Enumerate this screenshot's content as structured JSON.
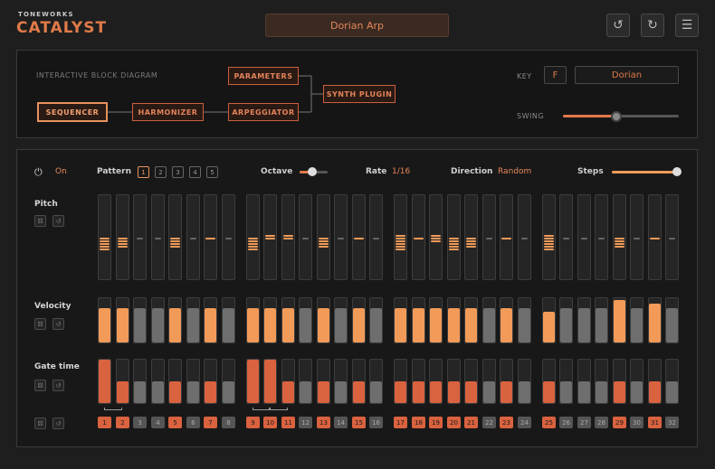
{
  "brand": {
    "small": "TONEWORKS",
    "big": "CATALYST"
  },
  "preset": "Dorian Arp",
  "icons": {
    "undo": "undo-icon",
    "redo": "redo-icon",
    "menu": "menu-icon",
    "power": "power-icon",
    "dice": "dice-icon",
    "reset": "reset-icon"
  },
  "diagram": {
    "title": "INTERACTIVE BLOCK DIAGRAM",
    "blocks": {
      "sequencer": "SEQUENCER",
      "harmonizer": "HARMONIZER",
      "arpeggiator": "ARPEGGIATOR",
      "parameters": "PARAMETERS",
      "synth": "SYNTH PLUGIN"
    }
  },
  "key": {
    "label": "KEY",
    "note": "F",
    "scale": "Dorian"
  },
  "swing": {
    "label": "SWING",
    "value": 0.45
  },
  "controls": {
    "on_label": "On",
    "pattern_label": "Pattern",
    "patterns": [
      "1",
      "2",
      "3",
      "4",
      "5"
    ],
    "active_pattern": 0,
    "octave_label": "Octave",
    "octave_value": 0.45,
    "rate_label": "Rate",
    "rate_value": "1/16",
    "direction_label": "Direction",
    "direction_value": "Random",
    "steps_label": "Steps",
    "steps_value": 1.0
  },
  "rows": {
    "pitch": "Pitch",
    "velocity": "Velocity",
    "gate": "Gate time"
  },
  "colors": {
    "orange": "#f29a58",
    "orange_dark": "#d9623f",
    "gray": "#6e6e6e",
    "accent": "#e07a4a"
  },
  "steps": [
    {
      "n": "1",
      "on": true,
      "pitch": 5,
      "vel": 0.78,
      "vel_on": true,
      "gate": 1.0,
      "tie": true
    },
    {
      "n": "2",
      "on": true,
      "pitch": 4,
      "vel": 0.78,
      "vel_on": true,
      "gate": 0.5,
      "tie": false
    },
    {
      "n": "3",
      "on": false,
      "pitch": 0,
      "vel": 0.78,
      "vel_on": false,
      "gate": 0.5,
      "tie": false
    },
    {
      "n": "4",
      "on": false,
      "pitch": 0,
      "vel": 0.78,
      "vel_on": false,
      "gate": 0.5,
      "tie": false
    },
    {
      "n": "5",
      "on": true,
      "pitch": 4,
      "vel": 0.78,
      "vel_on": true,
      "gate": 0.5,
      "tie": false
    },
    {
      "n": "6",
      "on": false,
      "pitch": 0,
      "vel": 0.78,
      "vel_on": false,
      "gate": 0.5,
      "tie": false
    },
    {
      "n": "7",
      "on": true,
      "pitch": 1,
      "vel": 0.78,
      "vel_on": true,
      "gate": 0.5,
      "tie": false
    },
    {
      "n": "8",
      "on": false,
      "pitch": 0,
      "vel": 0.78,
      "vel_on": false,
      "gate": 0.5,
      "tie": false
    },
    {
      "n": "9",
      "on": true,
      "pitch": 5,
      "vel": 0.78,
      "vel_on": true,
      "gate": 1.0,
      "tie": true
    },
    {
      "n": "10",
      "on": true,
      "pitch": 2,
      "vel": 0.78,
      "vel_on": true,
      "gate": 1.0,
      "tie": true
    },
    {
      "n": "11",
      "on": true,
      "pitch": 2,
      "vel": 0.78,
      "vel_on": true,
      "gate": 0.5,
      "tie": false
    },
    {
      "n": "12",
      "on": false,
      "pitch": 0,
      "vel": 0.78,
      "vel_on": false,
      "gate": 0.5,
      "tie": false
    },
    {
      "n": "13",
      "on": true,
      "pitch": 4,
      "vel": 0.78,
      "vel_on": true,
      "gate": 0.5,
      "tie": false
    },
    {
      "n": "14",
      "on": false,
      "pitch": 0,
      "vel": 0.78,
      "vel_on": false,
      "gate": 0.5,
      "tie": false
    },
    {
      "n": "15",
      "on": true,
      "pitch": 1,
      "vel": 0.78,
      "vel_on": true,
      "gate": 0.5,
      "tie": false
    },
    {
      "n": "16",
      "on": false,
      "pitch": 0,
      "vel": 0.78,
      "vel_on": false,
      "gate": 0.5,
      "tie": false
    },
    {
      "n": "17",
      "on": true,
      "pitch": 6,
      "vel": 0.78,
      "vel_on": true,
      "gate": 0.5,
      "tie": false
    },
    {
      "n": "18",
      "on": true,
      "pitch": 1,
      "vel": 0.78,
      "vel_on": true,
      "gate": 0.5,
      "tie": false
    },
    {
      "n": "19",
      "on": true,
      "pitch": 3,
      "vel": 0.78,
      "vel_on": true,
      "gate": 0.5,
      "tie": false
    },
    {
      "n": "20",
      "on": true,
      "pitch": 5,
      "vel": 0.78,
      "vel_on": true,
      "gate": 0.5,
      "tie": false
    },
    {
      "n": "21",
      "on": true,
      "pitch": 4,
      "vel": 0.78,
      "vel_on": true,
      "gate": 0.5,
      "tie": false
    },
    {
      "n": "22",
      "on": false,
      "pitch": 0,
      "vel": 0.78,
      "vel_on": false,
      "gate": 0.5,
      "tie": false
    },
    {
      "n": "23",
      "on": true,
      "pitch": 1,
      "vel": 0.78,
      "vel_on": true,
      "gate": 0.5,
      "tie": false
    },
    {
      "n": "24",
      "on": false,
      "pitch": 0,
      "vel": 0.78,
      "vel_on": false,
      "gate": 0.5,
      "tie": false
    },
    {
      "n": "25",
      "on": true,
      "pitch": 6,
      "vel": 0.7,
      "vel_on": true,
      "gate": 0.5,
      "tie": false
    },
    {
      "n": "26",
      "on": false,
      "pitch": 0,
      "vel": 0.78,
      "vel_on": false,
      "gate": 0.5,
      "tie": false
    },
    {
      "n": "27",
      "on": false,
      "pitch": 0,
      "vel": 0.78,
      "vel_on": false,
      "gate": 0.5,
      "tie": false
    },
    {
      "n": "28",
      "on": false,
      "pitch": 0,
      "vel": 0.78,
      "vel_on": false,
      "gate": 0.5,
      "tie": false
    },
    {
      "n": "29",
      "on": true,
      "pitch": 4,
      "vel": 0.95,
      "vel_on": true,
      "gate": 0.5,
      "tie": false
    },
    {
      "n": "30",
      "on": false,
      "pitch": 0,
      "vel": 0.78,
      "vel_on": false,
      "gate": 0.5,
      "tie": false
    },
    {
      "n": "31",
      "on": true,
      "pitch": 1,
      "vel": 0.88,
      "vel_on": true,
      "gate": 0.5,
      "tie": false
    },
    {
      "n": "32",
      "on": false,
      "pitch": 0,
      "vel": 0.78,
      "vel_on": false,
      "gate": 0.5,
      "tie": false
    }
  ]
}
